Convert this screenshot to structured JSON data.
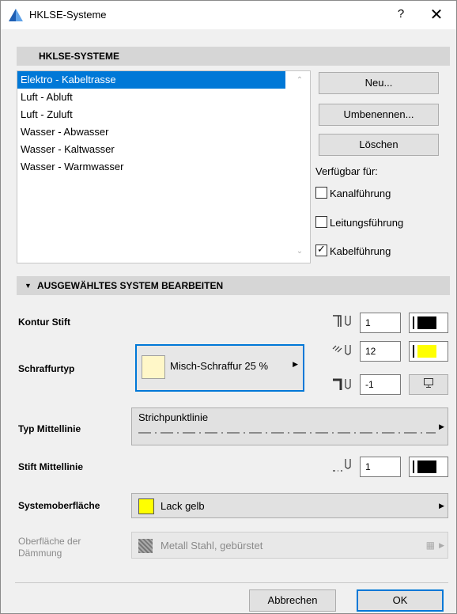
{
  "window": {
    "title": "HKLSE-Systeme",
    "help_label": "?",
    "close_label": "✕"
  },
  "systems_section": {
    "header": "HKLSE-SYSTEME",
    "items": [
      "Elektro - Kabeltrasse",
      "Luft - Abluft",
      "Luft - Zuluft",
      "Wasser - Abwasser",
      "Wasser - Kaltwasser",
      "Wasser - Warmwasser"
    ],
    "selected_index": 0,
    "new_button": "Neu...",
    "rename_button": "Umbenennen...",
    "delete_button": "Löschen",
    "available_for_label": "Verfügbar für:",
    "checkboxes": [
      {
        "label": "Kanalführung",
        "checked": false
      },
      {
        "label": "Leitungsführung",
        "checked": false
      },
      {
        "label": "Kabelführung",
        "checked": true
      }
    ]
  },
  "edit_section": {
    "header": "AUSGEWÄHLTES SYSTEM BEARBEITEN",
    "contour_pen_label": "Kontur Stift",
    "contour_pen_value": "1",
    "hatch_type_label": "Schraffurtyp",
    "hatch_type_value": "Misch-Schraffur 25 %",
    "hatch_fg_pen_value": "12",
    "hatch_bg_pen_value": "-1",
    "centerline_type_label": "Typ Mittellinie",
    "centerline_type_value": "Strichpunktlinie",
    "centerline_pen_label": "Stift Mittellinie",
    "centerline_pen_value": "1",
    "system_surface_label": "Systemoberfläche",
    "system_surface_value": "Lack gelb",
    "insulation_surface_label": "Oberfläche der Dämmung",
    "insulation_surface_value": "Metall Stahl, gebürstet"
  },
  "footer": {
    "cancel_button": "Abbrechen",
    "ok_button": "OK"
  },
  "colors": {
    "accent": "#0078d7",
    "yellow": "#ffff00",
    "black": "#000000"
  }
}
